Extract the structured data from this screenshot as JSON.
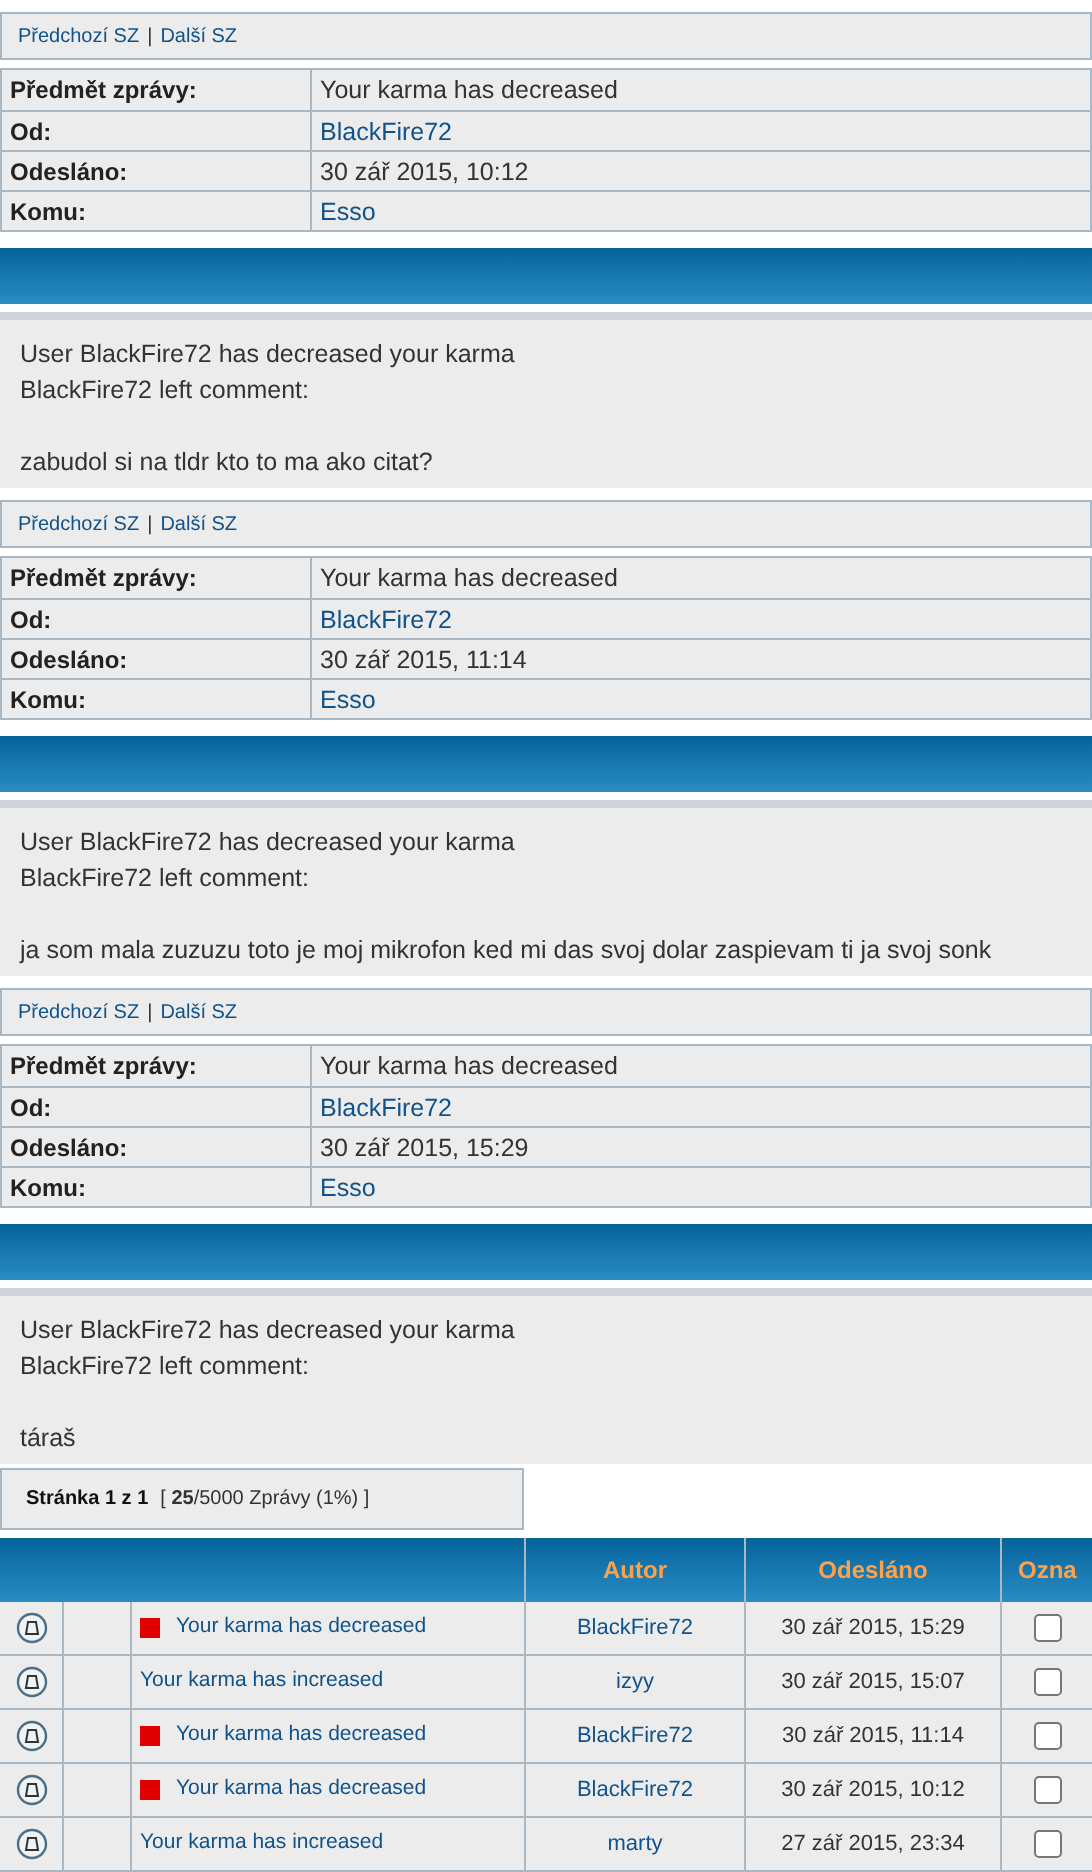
{
  "messages": [
    {
      "nav": {
        "prev": "Předchozí SZ",
        "separator": "|",
        "next": "Další SZ"
      },
      "fields": [
        {
          "label": "Předmět zprávy:",
          "value": "Your karma has decreased",
          "kind": "text"
        },
        {
          "label": "Od:",
          "value": "BlackFire72",
          "kind": "link"
        },
        {
          "label": "Odesláno:",
          "value": "30 zář 2015, 10:12",
          "kind": "text"
        },
        {
          "label": "Komu:",
          "value": "Esso",
          "kind": "link"
        }
      ],
      "body": [
        [
          "User BlackFire72 has decreased your karma",
          "BlackFire72 left comment:"
        ],
        [
          "zabudol si na tldr kto to ma ako citat?"
        ]
      ]
    },
    {
      "nav": {
        "prev": "Předchozí SZ",
        "separator": "|",
        "next": "Další SZ"
      },
      "fields": [
        {
          "label": "Předmět zprávy:",
          "value": "Your karma has decreased",
          "kind": "text"
        },
        {
          "label": "Od:",
          "value": "BlackFire72",
          "kind": "link"
        },
        {
          "label": "Odesláno:",
          "value": "30 zář 2015, 11:14",
          "kind": "text"
        },
        {
          "label": "Komu:",
          "value": "Esso",
          "kind": "link"
        }
      ],
      "body": [
        [
          "User BlackFire72 has decreased your karma",
          "BlackFire72 left comment:"
        ],
        [
          "ja som mala zuzuzu toto je moj mikrofon ked mi das svoj dolar zaspievam ti ja svoj sonk"
        ]
      ]
    },
    {
      "nav": {
        "prev": "Předchozí SZ",
        "separator": "|",
        "next": "Další SZ"
      },
      "fields": [
        {
          "label": "Předmět zprávy:",
          "value": "Your karma has decreased",
          "kind": "text"
        },
        {
          "label": "Od:",
          "value": "BlackFire72",
          "kind": "link"
        },
        {
          "label": "Odesláno:",
          "value": "30 zář 2015, 15:29",
          "kind": "text"
        },
        {
          "label": "Komu:",
          "value": "Esso",
          "kind": "link"
        }
      ],
      "body": [
        [
          "User BlackFire72 has decreased your karma",
          "BlackFire72 left comment:"
        ],
        [
          "táraš"
        ]
      ]
    }
  ],
  "pagination": {
    "page": "Stránka 1 z 1",
    "open": "[",
    "count": "25",
    "total": "/5000 Zprávy (1%)",
    "close": "]"
  },
  "inbox": {
    "columns": [
      "Autor",
      "Odesláno",
      "Ozna"
    ],
    "rows": [
      {
        "flagged": true,
        "subject": "Your karma has decreased",
        "author": "BlackFire72",
        "sent": "30 zář 2015, 15:29",
        "checked": false
      },
      {
        "flagged": false,
        "subject": "Your karma has increased",
        "author": "izyy",
        "sent": "30 zář 2015, 15:07",
        "checked": false
      },
      {
        "flagged": true,
        "subject": "Your karma has decreased",
        "author": "BlackFire72",
        "sent": "30 zář 2015, 11:14",
        "checked": false
      },
      {
        "flagged": true,
        "subject": "Your karma has decreased",
        "author": "BlackFire72",
        "sent": "30 zář 2015, 10:12",
        "checked": false
      },
      {
        "flagged": false,
        "subject": "Your karma has increased",
        "author": "marty",
        "sent": "27 zář 2015, 23:34",
        "checked": false
      }
    ]
  }
}
